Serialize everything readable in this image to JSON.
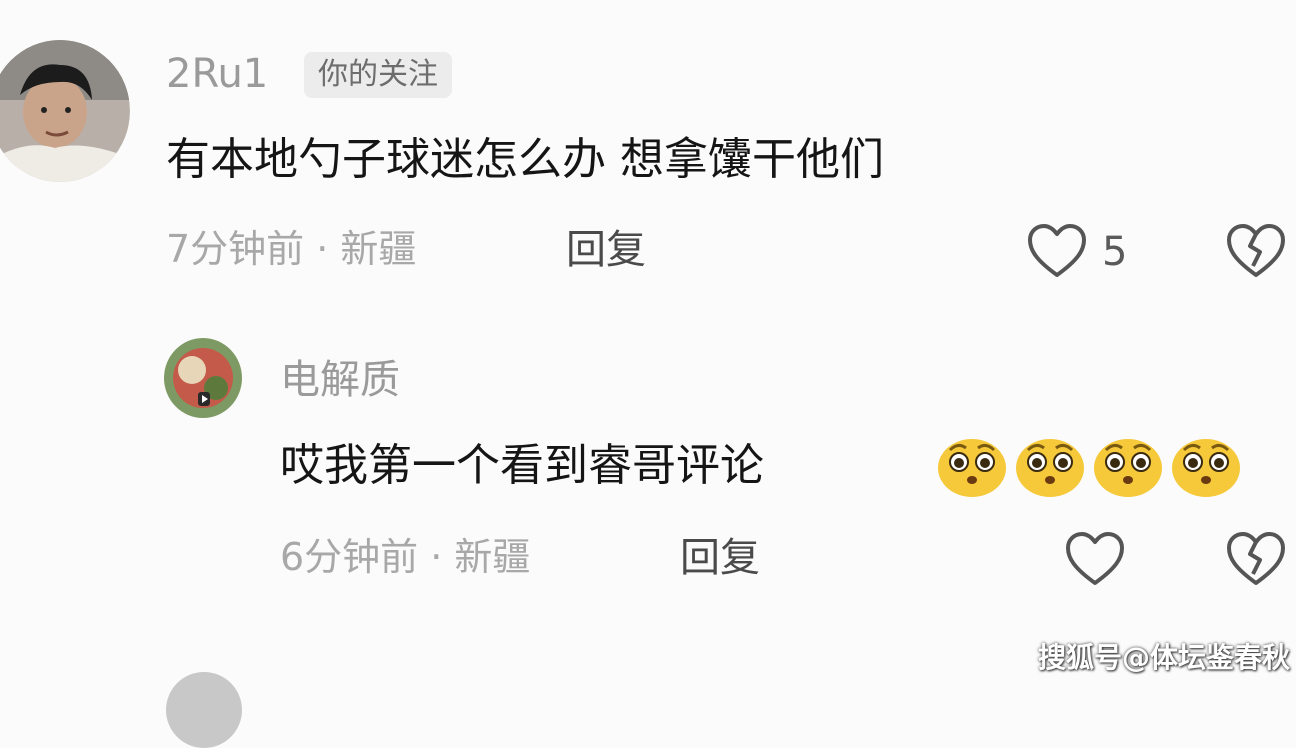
{
  "comments": [
    {
      "username": "2Ru1",
      "badge": "你的关注",
      "text": "有本地勺子球迷怎么办 想拿馕干他们",
      "time_location": "7分钟前 · 新疆",
      "reply_label": "回复",
      "like_count": "5",
      "avatar_icon": "user-avatar-photo"
    },
    {
      "username": "电解质",
      "text": "哎我第一个看到睿哥评论",
      "emoji_count": 4,
      "emoji_icon": "pleading-face-emoji",
      "time_location": "6分钟前 · 新疆",
      "reply_label": "回复",
      "avatar_icon": "user-avatar-photo"
    }
  ],
  "watermark": "搜狐号@体坛鉴春秋",
  "colors": {
    "background": "#fbfbfb",
    "username": "#9a9a9a",
    "meta": "#a8a8a8",
    "heart_outline": "#555555",
    "emoji_yellow": "#f5c93a"
  }
}
